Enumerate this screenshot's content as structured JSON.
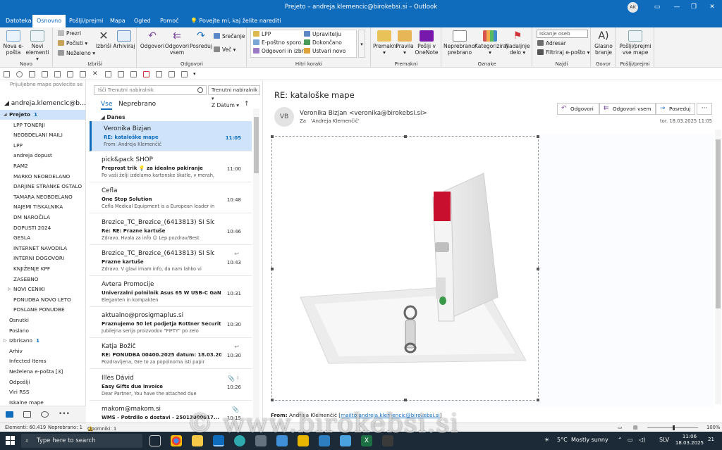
{
  "window": {
    "title": "Prejeto – andreja.klemencic@birokebsi.si – Outlook",
    "avatar_initials": "AK",
    "accent": "#0f6cbd"
  },
  "tabs": [
    {
      "label": "Datoteka",
      "active": false
    },
    {
      "label": "Osnovno",
      "active": true
    },
    {
      "label": "Pošlji/prejmi",
      "active": false
    },
    {
      "label": "Mapa",
      "active": false
    },
    {
      "label": "Ogled",
      "active": false
    },
    {
      "label": "Pomoč",
      "active": false
    }
  ],
  "tellme": "Povejte mi, kaj želite narediti",
  "ribbon": {
    "groups": [
      {
        "label": "Novo"
      },
      {
        "label": "Izbriši"
      },
      {
        "label": "Odgovori"
      },
      {
        "label": "Hitri koraki"
      },
      {
        "label": "Premakni"
      },
      {
        "label": "Oznake"
      },
      {
        "label": "Najdi"
      },
      {
        "label": "Govor"
      },
      {
        "label": "Pošlji/prejmi"
      }
    ],
    "new_email": "Nova e-pošta",
    "new_items": "Novi elementi ▾",
    "ignore": "Prezri",
    "clean": "Počisti ▾",
    "junk": "Neželeno ▾",
    "delete": "Izbriši",
    "archive": "Arhiviraj",
    "reply": "Odgovori",
    "reply_all": "Odgovori vsem",
    "forward": "Posreduj",
    "meeting": "Srečanje",
    "more": "Več ▾",
    "qs": [
      "LPP",
      "E-poštno sporo...",
      "Odgovori in izbriši",
      "Upravitelju",
      "Dokončano",
      "Ustvari novo"
    ],
    "move": "Premakni ▾",
    "rules": "Pravila ▾",
    "onenote": "Pošlji v OneNote",
    "unread": "Neprebrano/ prebrano",
    "categorize": "Kategoriziraj ▾",
    "followup": "Nadaljnje delo ▾",
    "search_people": "Iskanje oseb",
    "address_book": "Adresar",
    "filter_email": "Filtriraj e-pošto ▾",
    "read_aloud": "Glasno branje",
    "send_receive": "Pošlji/prejmi vse mape"
  },
  "folder_pane": {
    "hint": "Prijuljebne mape povlecite se",
    "account": "andreja.klemencic@b...",
    "folders": [
      {
        "label": "Prejeto",
        "count": "1",
        "level": 0,
        "selected": true,
        "caret": "◢"
      },
      {
        "label": "LPP TONERJI",
        "count": "",
        "level": 1
      },
      {
        "label": "NEOBDELANI MAILI",
        "count": "",
        "level": 1
      },
      {
        "label": "LPP",
        "count": "",
        "level": 1
      },
      {
        "label": "andreja dopust",
        "count": "",
        "level": 1
      },
      {
        "label": "RAM2",
        "count": "",
        "level": 1
      },
      {
        "label": "MARKO NEOBDELANO",
        "count": "",
        "level": 1
      },
      {
        "label": "DARJINE STRANKE OSTALO",
        "count": "",
        "level": 1
      },
      {
        "label": "TAMARA NEOBDELANO",
        "count": "",
        "level": 1
      },
      {
        "label": "NAJEMI TISKALNIKA",
        "count": "",
        "level": 1
      },
      {
        "label": "DM NAROČILA",
        "count": "",
        "level": 1
      },
      {
        "label": "DOPUSTI 2024",
        "count": "",
        "level": 1
      },
      {
        "label": "GESLA",
        "count": "",
        "level": 1
      },
      {
        "label": "INTERNET NAVODILA",
        "count": "",
        "level": 1
      },
      {
        "label": "INTERNI DOGOVORI",
        "count": "",
        "level": 1
      },
      {
        "label": "KNJIŽENJE KPF",
        "count": "",
        "level": 1
      },
      {
        "label": "ZASEBNO",
        "count": "",
        "level": 1
      },
      {
        "label": "NOVI CENIKI",
        "count": "",
        "level": 1,
        "caret": "▷"
      },
      {
        "label": "PONUDBA NOVO LETO",
        "count": "",
        "level": 1
      },
      {
        "label": "POSLANE PONUDBE",
        "count": "",
        "level": 1
      },
      {
        "label": "Osnutki",
        "count": "",
        "level": 0
      },
      {
        "label": "Poslano",
        "count": "",
        "level": 0
      },
      {
        "label": "Izbrisano",
        "count": "1",
        "level": 0,
        "caret": "▷"
      },
      {
        "label": "Arhiv",
        "count": "",
        "level": 0
      },
      {
        "label": "Infected Items",
        "count": "",
        "level": 0
      },
      {
        "label": "Neželena e-pošta [3]",
        "count": "",
        "level": 0
      },
      {
        "label": "Odpošlji",
        "count": "",
        "level": 0
      },
      {
        "label": "Viri RSS",
        "count": "",
        "level": 0
      },
      {
        "label": "Iskalne mape",
        "count": "",
        "level": 0
      }
    ]
  },
  "message_list": {
    "search_placeholder": "Išči Trenutni nabiralnik",
    "scope": "Trenutni nabiralnik",
    "filter_all": "Vse",
    "filter_unread": "Neprebrano",
    "sort": "Z Datum ▾",
    "group": "Danes",
    "messages": [
      {
        "from": "Veronika Bizjan",
        "subject": "RE: kataloške mape",
        "preview": "From: Andreja Klemenčič",
        "time": "11:05",
        "selected": true,
        "icon": ""
      },
      {
        "from": "pick&pack SHOP",
        "subject": "Preprost trik 💡 za idealno pakiranje",
        "preview": "Po vaši želji izdelamo kartonske škatle, v merah,",
        "time": "11:00",
        "icon": ""
      },
      {
        "from": "Cefla",
        "subject": "One Stop Solution",
        "preview": "Cefla Medical Equipment is a European leader in",
        "time": "10:48",
        "icon": ""
      },
      {
        "from": "Brezice_TC_Brezice_(6413813) SI Slo...",
        "subject": "Re:  RE: Prazne kartuše",
        "preview": "Zdravo.  Hvala za info 😊  Lep pozdrav/Best",
        "time": "10:46",
        "icon": ""
      },
      {
        "from": "Brezice_TC_Brezice_(6413813) SI Slo...",
        "subject": "Prazne kartuše",
        "preview": "Zdravo.  V glavi imam info, da nam lahko vi",
        "time": "10:43",
        "icon": "↩"
      },
      {
        "from": "Avtera Promocije",
        "subject": "Univerzalni polnilnik Asus 65 W USB-C GaN",
        "preview": "Eleganten in kompakten",
        "time": "10:31",
        "icon": ""
      },
      {
        "from": "aktualno@prosigmaplus.si",
        "subject": "Praznujemo 50 let podjetja Rottner Security 🎓",
        "preview": "Jubilejna serija proizvodov \"FIFTY\" po zelo",
        "time": "10:30",
        "icon": ""
      },
      {
        "from": "Katja Božič",
        "subject": "RE: PONUDBA 00400.2025 datum: 18.03.2025 k...",
        "preview": "Pozdravljena,  Gre to za popolnoma isti papir",
        "time": "10:30",
        "icon": "↩"
      },
      {
        "from": "Illés Dávid",
        "subject": "Easy Gifts due invoice",
        "preview": "Dear Partner,  You have the attached due",
        "time": "10:26",
        "icon": "📎 !"
      },
      {
        "from": "makom@makom.si",
        "subject": "WMS - Potrdilo o dostavi - 25013000017...",
        "preview": "",
        "time": "10:15",
        "icon": "📎"
      }
    ]
  },
  "reading": {
    "subject": "RE: kataloške mape",
    "avatar": "VB",
    "from": "Veronika Bizjan <veronika@birokebsi.si>",
    "to_label": "Za",
    "to": "'Andreja Klemenčič'",
    "date": "tor. 18.03.2025 11:05",
    "btn_reply": "Odgovori",
    "btn_reply_all": "Odgovori vsem",
    "btn_forward": "Posreduj",
    "btn_more": "···",
    "bottom_from_label": "From:",
    "bottom_from": "Andreja Klemenčič [",
    "bottom_link": "mailto:andreja.klemencic@birokebsi.si",
    "bottom_end": "]"
  },
  "status": {
    "items": "Elementi: 60.419",
    "unread": "Neprebrano: 1",
    "reminders": "Opomniki: 1",
    "zoom": "100%"
  },
  "taskbar": {
    "search": "Type here to search",
    "weather_temp": "5°C",
    "weather_text": "Mostly sunny",
    "lang": "SLV",
    "time": "11:06",
    "date": "18.03.2025",
    "notif": "21"
  },
  "watermark": "© www.birokebsi.si"
}
